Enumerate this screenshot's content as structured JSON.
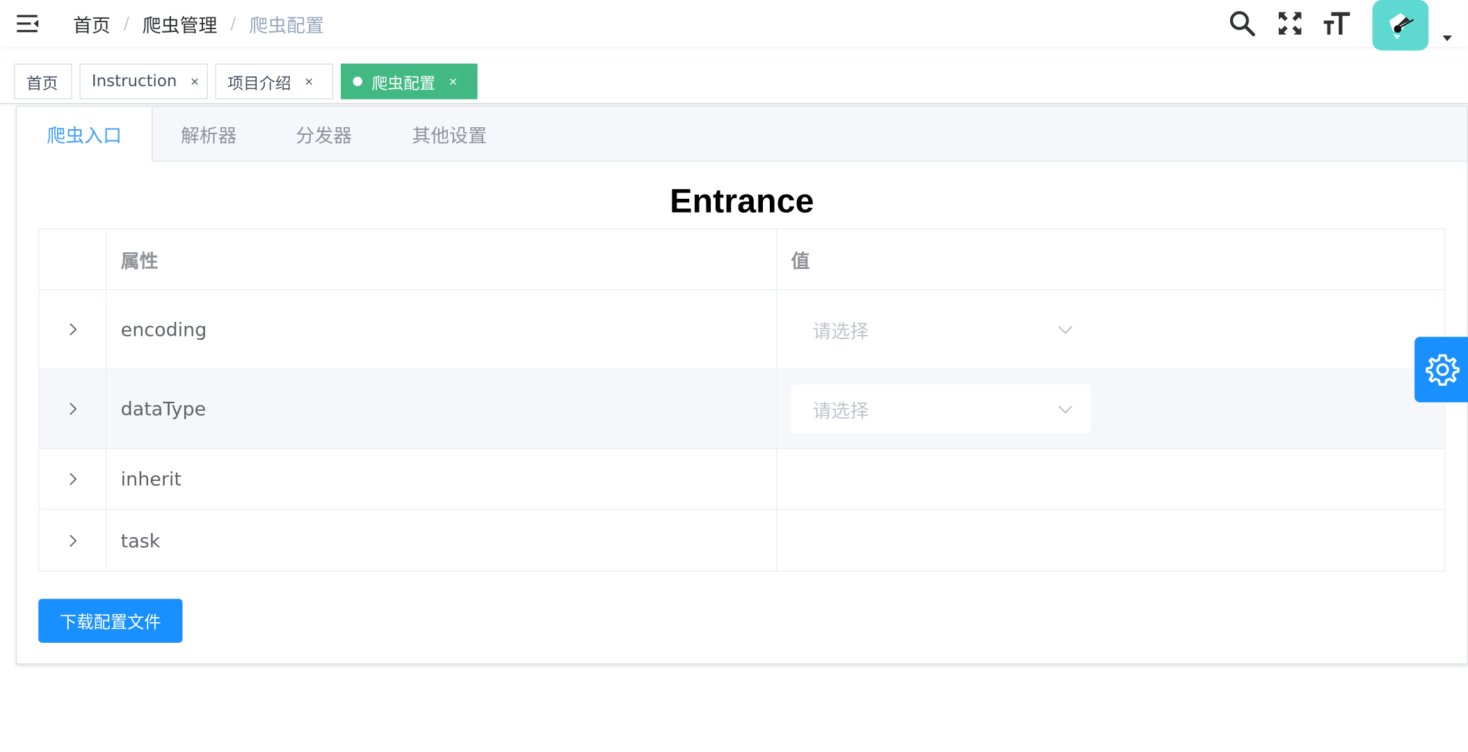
{
  "breadcrumb": {
    "items": [
      "首页",
      "爬虫管理",
      "爬虫配置"
    ],
    "separator": "/"
  },
  "tags": [
    {
      "label": "首页",
      "closable": false,
      "active": false
    },
    {
      "label": "Instruction",
      "closable": true,
      "active": false
    },
    {
      "label": "项目介绍",
      "closable": true,
      "active": false
    },
    {
      "label": "爬虫配置",
      "closable": true,
      "active": true
    }
  ],
  "tag_close_glyph": "×",
  "tabs": [
    "爬虫入口",
    "解析器",
    "分发器",
    "其他设置"
  ],
  "section_title": "Entrance",
  "table": {
    "headers": [
      "属性",
      "值"
    ],
    "rows": [
      {
        "name": "encoding",
        "placeholder": "请选择"
      },
      {
        "name": "dataType",
        "placeholder": "请选择"
      },
      {
        "name": "inherit"
      },
      {
        "name": "task"
      }
    ]
  },
  "download_button": "下载配置文件",
  "colors": {
    "active_tag": "#42b983",
    "primary": "#1890ff",
    "tab_active": "#409eff",
    "avatar_bg": "#5ed9d1"
  },
  "icons": [
    "hamburger-icon",
    "search-icon",
    "fullscreen-icon",
    "font-size-icon",
    "avatar",
    "caret-down-icon",
    "close-icon",
    "chevron-right-icon",
    "chevron-down-icon",
    "gear-icon"
  ]
}
